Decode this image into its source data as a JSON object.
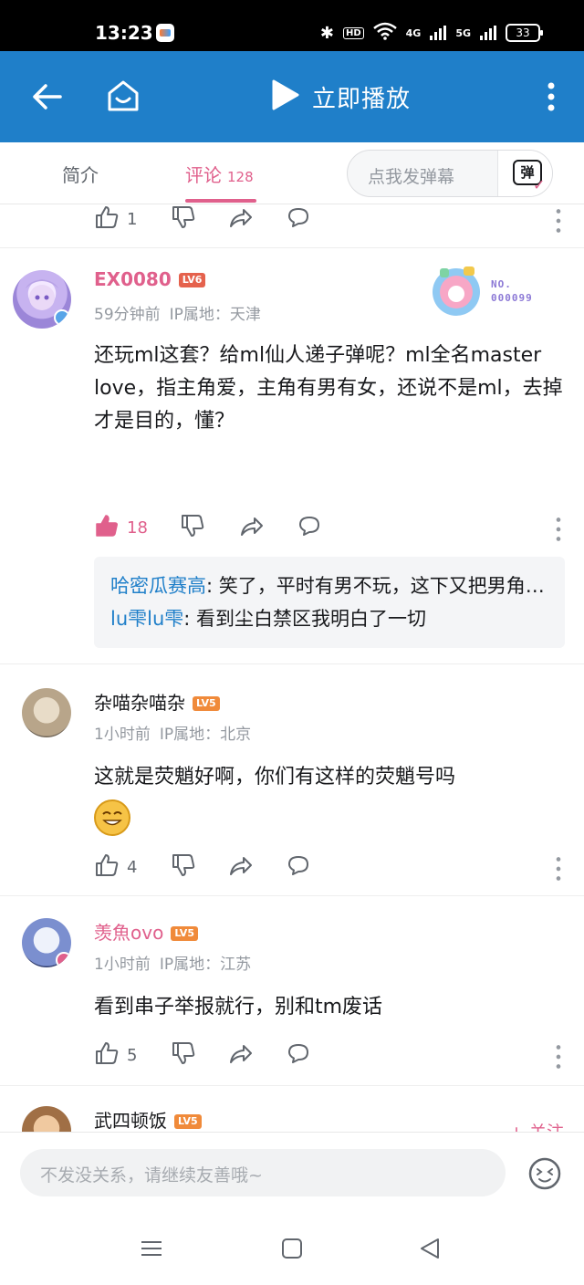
{
  "status_bar": {
    "time": "13:23",
    "hd": "HD",
    "net1": "4G",
    "net2": "5G",
    "battery": "33"
  },
  "app_bar": {
    "play_label": "立即播放"
  },
  "tabs": {
    "intro": "简介",
    "comments": "评论",
    "comments_count": "128"
  },
  "danmaku": {
    "placeholder": "点我发弹幕",
    "button_glyph": "弹"
  },
  "partial_actions": {
    "like_count": "1"
  },
  "comments": [
    {
      "username": "EX0080",
      "level": "LV6",
      "time": "59分钟前",
      "ip": "IP属地：天津",
      "badge_no": "NO.",
      "badge_num": "000099",
      "text": "还玩ml这套？给ml仙人递子弹呢？ml全名master love，指主角爱，主角有男有女，还说不是ml，去掉才是目的，懂？",
      "like_count": "18",
      "replies": [
        {
          "name": "哈密瓜赛高",
          "text": ": 笑了，平时有男不玩，这下又把男角色拉回ml了。而且up是cp党，不是..."
        },
        {
          "name": "lu雫lu雫",
          "text": ": 看到尘白禁区我明白了一切"
        }
      ]
    },
    {
      "username": "杂喵杂喵杂",
      "level": "LV5",
      "time": "1小时前",
      "ip": "IP属地：北京",
      "text": "这就是荧魈好啊，你们有这样的荧魈号吗",
      "like_count": "4"
    },
    {
      "username": "羡魚ovo",
      "level": "LV5",
      "time": "1小时前",
      "ip": "IP属地：江苏",
      "text": "看到串子举报就行，别和tm废话",
      "like_count": "5"
    },
    {
      "username": "武四顿饭",
      "level": "LV5",
      "follow": "+ 关注"
    }
  ],
  "input": {
    "placeholder": "不发没关系，请继续友善哦~"
  },
  "colors": {
    "header_blue": "#1f7fc9",
    "accent_pink": "#e0608c",
    "link_blue": "#1f7fc9"
  }
}
